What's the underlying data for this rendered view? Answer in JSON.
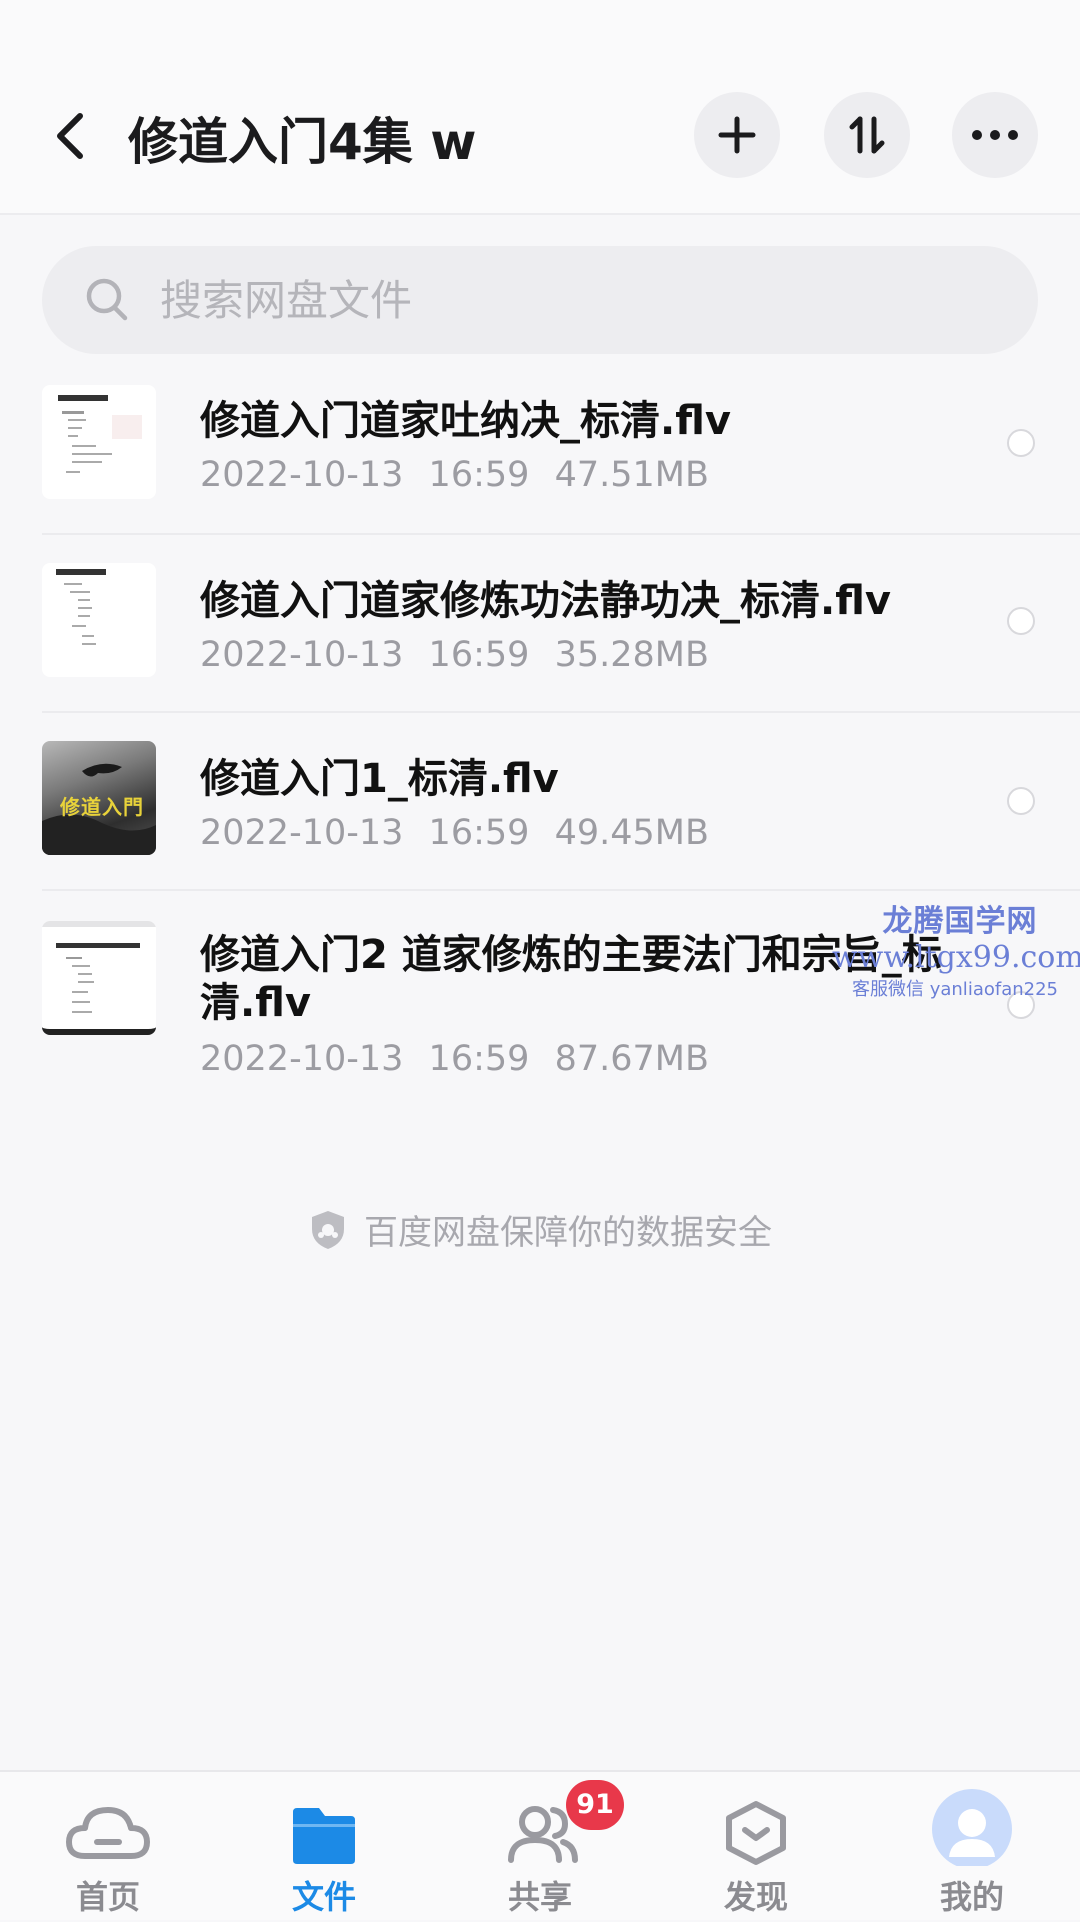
{
  "header": {
    "title": "修道入门4集 w",
    "back_icon": "chevron-left-icon",
    "actions": [
      "plus-icon",
      "sort-icon",
      "more-icon"
    ]
  },
  "search": {
    "placeholder": "搜索网盘文件"
  },
  "files": [
    {
      "name": "修道入门道家吐纳决_标清.flv",
      "date": "2022-10-13",
      "time": "16:59",
      "size": "47.51MB"
    },
    {
      "name": "修道入门道家修炼功法静功决_标清.flv",
      "date": "2022-10-13",
      "time": "16:59",
      "size": "35.28MB"
    },
    {
      "name": "修道入门1_标清.flv",
      "date": "2022-10-13",
      "time": "16:59",
      "size": "49.45MB",
      "thumb_text": "修道入門"
    },
    {
      "name": "修道入门2 道家修炼的主要法门和宗旨_标清.flv",
      "date": "2022-10-13",
      "time": "16:59",
      "size": "87.67MB"
    }
  ],
  "watermark": {
    "brand": "龙腾国学网",
    "url": "www.ltgx99.com",
    "contact": "客服微信 yanliaofan225"
  },
  "security_note": "百度网盘保障你的数据安全",
  "tabbar": {
    "tabs": [
      {
        "label": "首页",
        "icon": "cloud-icon",
        "active": false
      },
      {
        "label": "文件",
        "icon": "folder-icon",
        "active": true
      },
      {
        "label": "共享",
        "icon": "people-icon",
        "active": false,
        "badge": "91"
      },
      {
        "label": "发现",
        "icon": "discover-icon",
        "active": false
      },
      {
        "label": "我的",
        "icon": "avatar-icon",
        "active": false
      }
    ]
  },
  "colors": {
    "accent": "#1c8ae6",
    "badge": "#e8384a",
    "watermark": "#6b7fd6"
  }
}
